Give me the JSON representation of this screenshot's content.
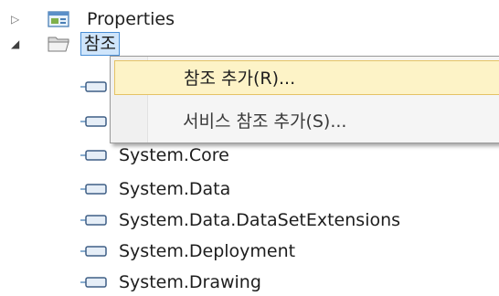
{
  "tree": {
    "properties_label": "Properties",
    "references_label": "참조",
    "references": [
      "System.Core",
      "System.Data",
      "System.Data.DataSetExtensions",
      "System.Deployment",
      "System.Drawing"
    ]
  },
  "context_menu": {
    "items": [
      {
        "label": "참조 추가(R)..."
      },
      {
        "label": "서비스 참조 추가(S)..."
      }
    ]
  },
  "colors": {
    "selection_border": "#4a8fd6",
    "selection_fill": "#cfe5fb",
    "menu_highlight_fill": "#fdf3c7",
    "menu_highlight_border": "#e5c365"
  }
}
